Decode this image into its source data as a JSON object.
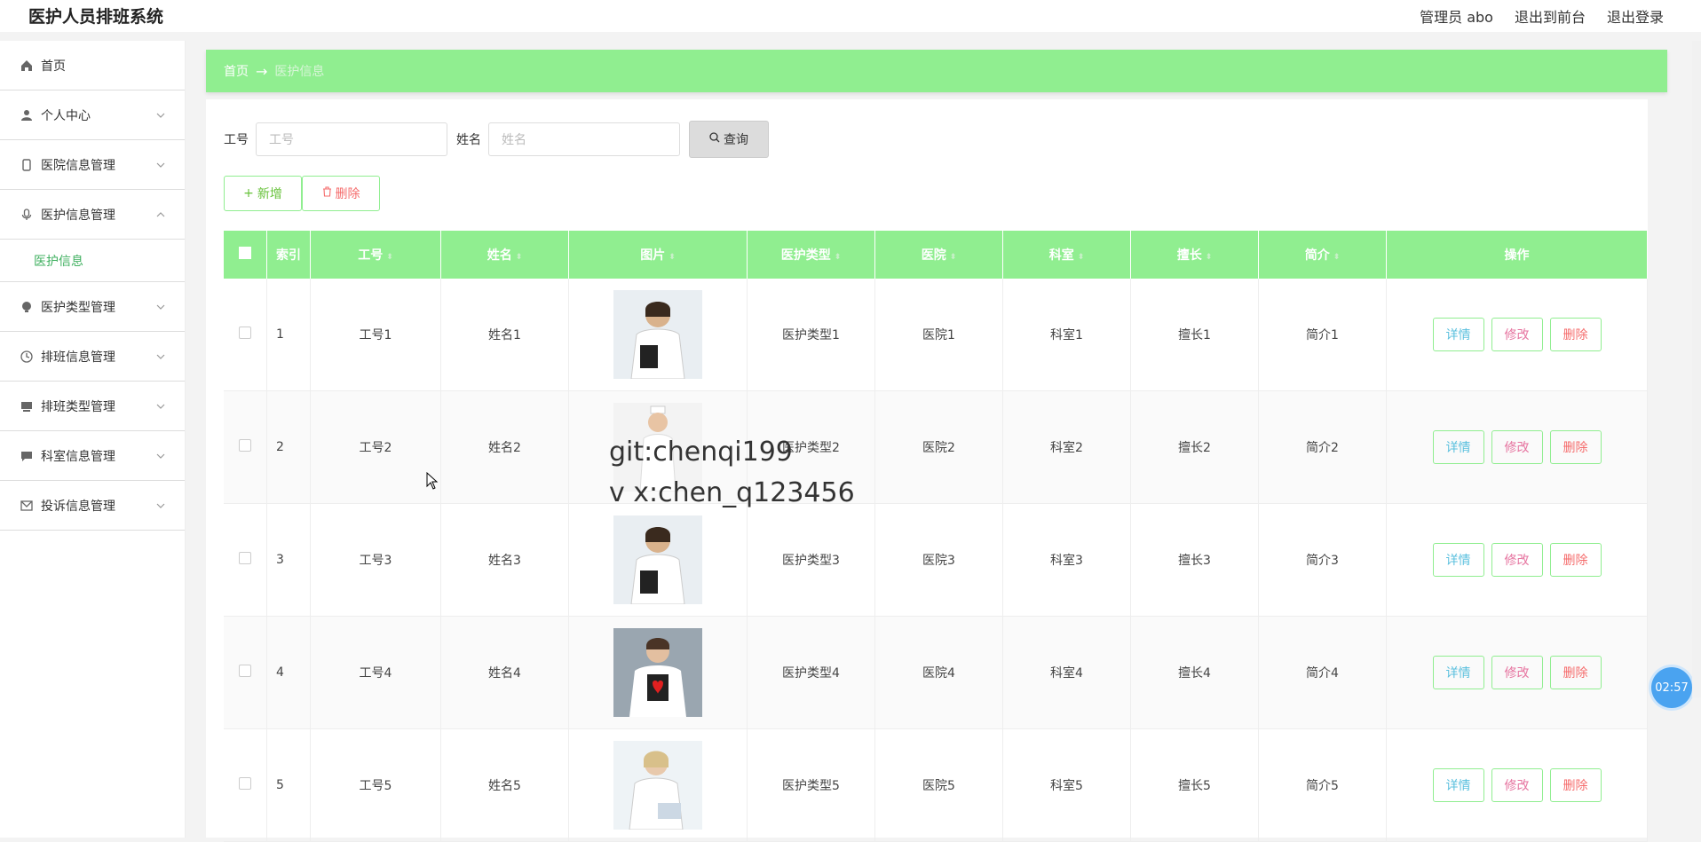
{
  "app": {
    "title": "医护人员排班系统"
  },
  "topnav": {
    "user": "管理员 abo",
    "to_front": "退出到前台",
    "logout": "退出登录"
  },
  "sidebar": {
    "items": [
      {
        "label": "首页"
      },
      {
        "label": "个人中心"
      },
      {
        "label": "医院信息管理"
      },
      {
        "label": "医护信息管理"
      },
      {
        "label": "医护类型管理"
      },
      {
        "label": "排班信息管理"
      },
      {
        "label": "排班类型管理"
      },
      {
        "label": "科室信息管理"
      },
      {
        "label": "投诉信息管理"
      }
    ],
    "submenu_active": "医护信息"
  },
  "breadcrumb": {
    "home": "首页",
    "arrow": "→",
    "current": "医护信息"
  },
  "search": {
    "job_no_label": "工号",
    "job_no_placeholder": "工号",
    "job_no_value": "",
    "name_label": "姓名",
    "name_placeholder": "姓名",
    "name_value": "",
    "query_button": "查询"
  },
  "actions": {
    "add": "新增",
    "delete": "删除"
  },
  "table": {
    "headers": [
      "索引",
      "工号",
      "姓名",
      "图片",
      "医护类型",
      "医院",
      "科室",
      "擅长",
      "简介",
      "操作"
    ],
    "rows": [
      {
        "idx": "1",
        "job_no": "工号1",
        "name": "姓名1",
        "type": "医护类型1",
        "hospital": "医院1",
        "dept": "科室1",
        "skill": "擅长1",
        "intro": "简介1"
      },
      {
        "idx": "2",
        "job_no": "工号2",
        "name": "姓名2",
        "type": "医护类型2",
        "hospital": "医院2",
        "dept": "科室2",
        "skill": "擅长2",
        "intro": "简介2"
      },
      {
        "idx": "3",
        "job_no": "工号3",
        "name": "姓名3",
        "type": "医护类型3",
        "hospital": "医院3",
        "dept": "科室3",
        "skill": "擅长3",
        "intro": "简介3"
      },
      {
        "idx": "4",
        "job_no": "工号4",
        "name": "姓名4",
        "type": "医护类型4",
        "hospital": "医院4",
        "dept": "科室4",
        "skill": "擅长4",
        "intro": "简介4"
      },
      {
        "idx": "5",
        "job_no": "工号5",
        "name": "姓名5",
        "type": "医护类型5",
        "hospital": "医院5",
        "dept": "科室5",
        "skill": "擅长5",
        "intro": "简介5"
      }
    ],
    "op_detail": "详情",
    "op_edit": "修改",
    "op_delete": "删除"
  },
  "watermark": {
    "line1": "git:chenqi199",
    "line2": "v x:chen_q123456"
  },
  "timer": "02:57",
  "colors": {
    "accent": "#90ee90",
    "active_menu": "#40b060"
  }
}
